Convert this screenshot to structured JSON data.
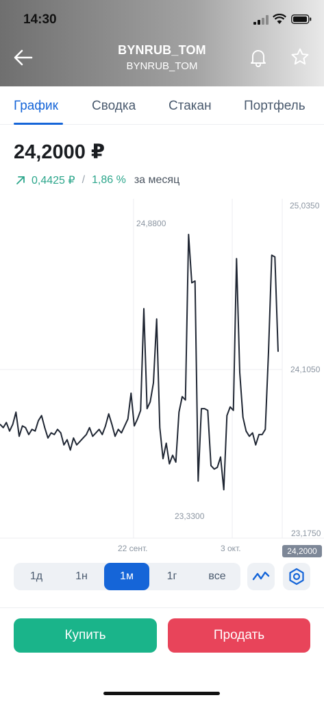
{
  "status_bar": {
    "time": "14:30"
  },
  "header": {
    "title": "BYNRUB_TOM",
    "subtitle": "BYNRUB_TOM"
  },
  "tabs": [
    {
      "label": "График",
      "active": true
    },
    {
      "label": "Сводка",
      "active": false
    },
    {
      "label": "Стакан",
      "active": false
    },
    {
      "label": "Портфель",
      "active": false
    }
  ],
  "quote": {
    "price": "24,2000 ₽",
    "change_abs": "0,4425 ₽",
    "separator": "/",
    "change_pct": "1,86 %",
    "period": "за месяц",
    "change_color": "#2aa58a"
  },
  "chart_labels": {
    "y_top": "25,0350",
    "y_mid": "24,1050",
    "y_bottom": "23,1750",
    "current": "24,2000",
    "max_label": "24,8800",
    "min_label": "23,3300",
    "x_ticks": [
      "22 сент.",
      "3 окт."
    ]
  },
  "chart_data": {
    "type": "line",
    "ylim": [
      23.175,
      25.035
    ],
    "yticks": [
      25.035,
      24.105,
      23.175
    ],
    "xticks": [
      "22 сент.",
      "3 окт."
    ],
    "annotations": {
      "max": 24.88,
      "min": 23.33,
      "last": 24.2
    },
    "values": [
      23.78,
      23.76,
      23.79,
      23.74,
      23.78,
      23.85,
      23.71,
      23.77,
      23.76,
      23.72,
      23.75,
      23.74,
      23.8,
      23.83,
      23.76,
      23.7,
      23.73,
      23.72,
      23.75,
      23.73,
      23.66,
      23.69,
      23.63,
      23.7,
      23.66,
      23.68,
      23.7,
      23.72,
      23.76,
      23.71,
      23.73,
      23.75,
      23.72,
      23.77,
      23.84,
      23.78,
      23.71,
      23.75,
      23.73,
      23.77,
      23.81,
      23.96,
      23.77,
      23.81,
      23.86,
      24.45,
      23.87,
      23.91,
      24.02,
      24.39,
      23.76,
      23.58,
      23.67,
      23.55,
      23.6,
      23.56,
      23.85,
      23.94,
      23.92,
      24.88,
      24.6,
      24.61,
      23.45,
      23.87,
      23.87,
      23.86,
      23.54,
      23.52,
      23.53,
      23.59,
      23.4,
      23.83,
      23.88,
      23.86,
      24.74,
      24.08,
      23.82,
      23.74,
      23.71,
      23.73,
      23.66,
      23.72,
      23.72,
      23.75,
      24.2,
      24.76,
      24.75,
      24.2
    ],
    "line_color": "#1f2633",
    "colors": {
      "accent": "#1565d8",
      "buy": "#1ab48a",
      "sell": "#e8445a"
    }
  },
  "ranges": [
    {
      "label": "1д",
      "active": false
    },
    {
      "label": "1н",
      "active": false
    },
    {
      "label": "1м",
      "active": true
    },
    {
      "label": "1г",
      "active": false
    },
    {
      "label": "все",
      "active": false
    }
  ],
  "tools": {
    "chart_type_icon": "line-chart-icon",
    "indicators_icon": "hexagon-settings-icon"
  },
  "actions": {
    "buy": "Купить",
    "sell": "Продать"
  }
}
